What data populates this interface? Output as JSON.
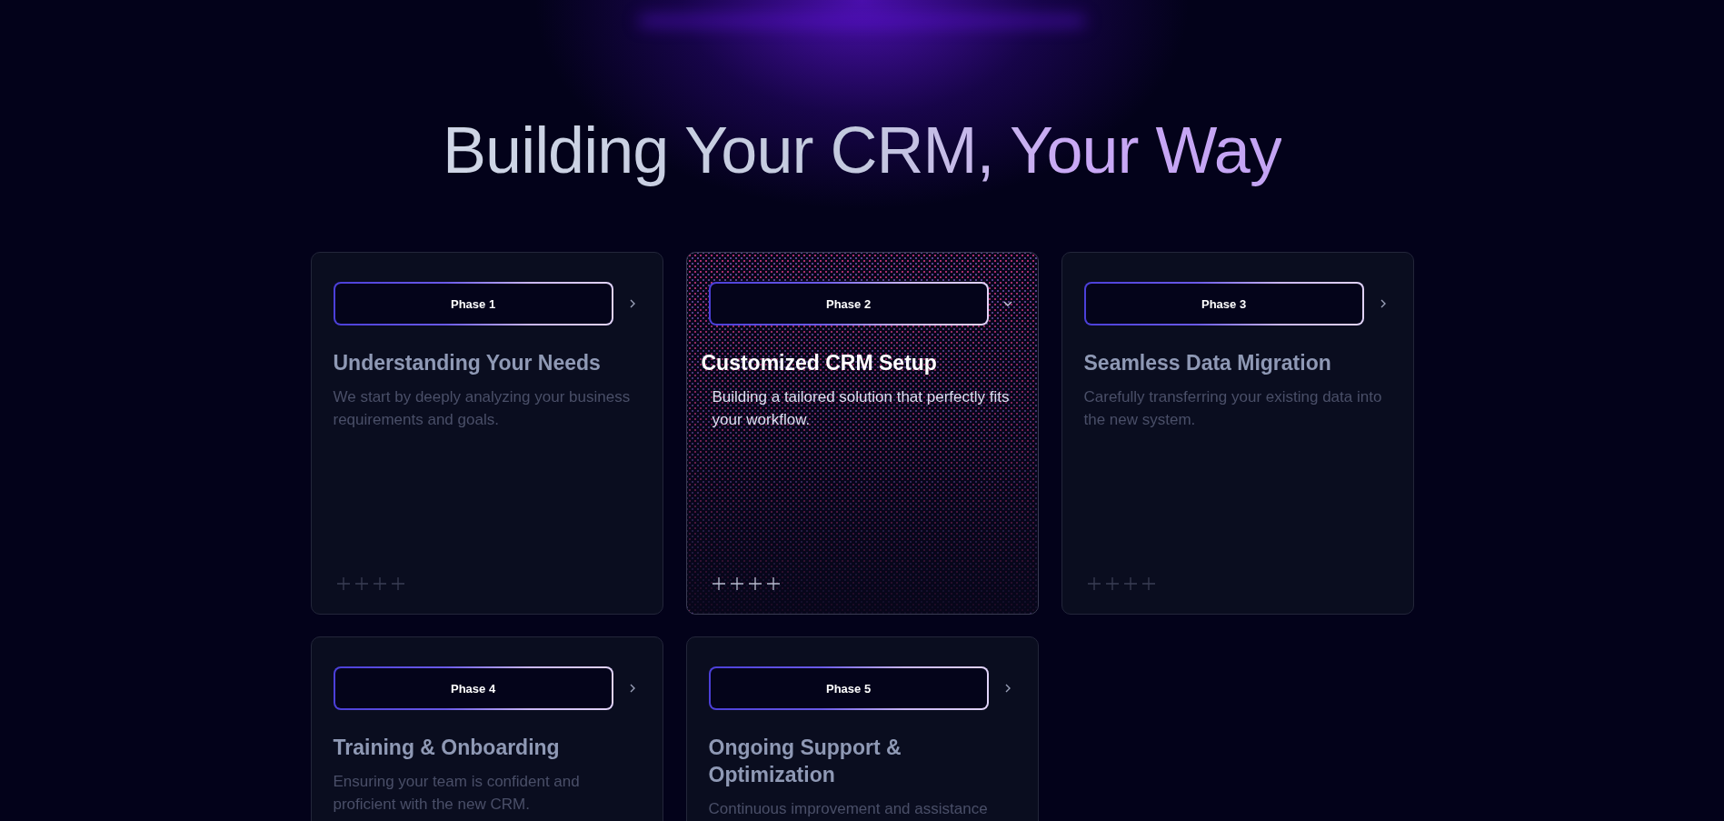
{
  "title": "Building Your CRM, Your Way",
  "phases": [
    {
      "label": "Phase 1",
      "title": "Understanding Your Needs",
      "description": "We start by deeply analyzing your business requirements and goals.",
      "expanded": false
    },
    {
      "label": "Phase 2",
      "title": "Customized CRM Setup",
      "description": "Building a tailored solution that perfectly fits your workflow.",
      "expanded": true
    },
    {
      "label": "Phase 3",
      "title": "Seamless Data Migration",
      "description": "Carefully transferring your existing data into the new system.",
      "expanded": false
    },
    {
      "label": "Phase 4",
      "title": "Training & Onboarding",
      "description": "Ensuring your team is confident and proficient with the new CRM.",
      "expanded": false
    },
    {
      "label": "Phase 5",
      "title": "Ongoing Support & Optimization",
      "description": "Continuous improvement and assistance",
      "expanded": false
    }
  ]
}
